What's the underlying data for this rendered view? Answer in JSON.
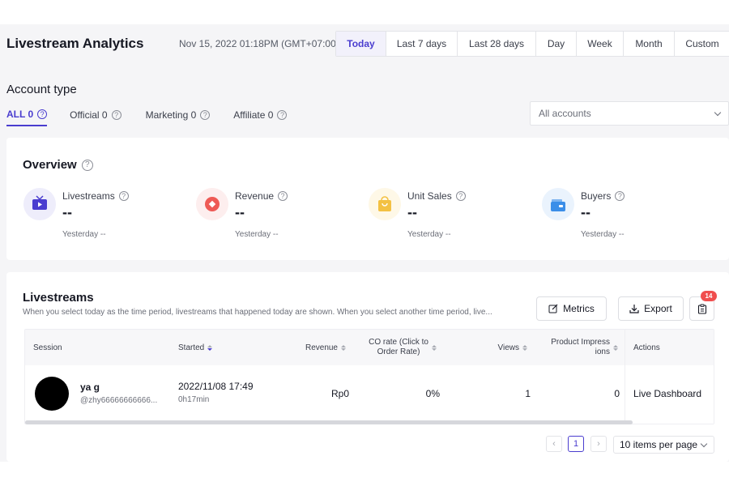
{
  "header": {
    "title": "Livestream Analytics",
    "datetime": "Nov 15, 2022 01:18PM (GMT+07:00)",
    "ranges": [
      "Today",
      "Last 7 days",
      "Last 28 days",
      "Day",
      "Week",
      "Month",
      "Custom"
    ],
    "active_range": "Today"
  },
  "account_type": {
    "title": "Account type",
    "tabs": [
      {
        "label": "ALL 0",
        "active": true
      },
      {
        "label": "Official 0",
        "active": false
      },
      {
        "label": "Marketing 0",
        "active": false
      },
      {
        "label": "Affiliate 0",
        "active": false
      }
    ],
    "select": {
      "value": "All accounts"
    }
  },
  "overview": {
    "title": "Overview",
    "metrics": [
      {
        "label": "Livestreams",
        "value": "--",
        "yesterday": "Yesterday --",
        "icon": "tv-icon",
        "color": "#4a3dcf",
        "bg": "#eeedfb"
      },
      {
        "label": "Revenue",
        "value": "--",
        "yesterday": "Yesterday --",
        "icon": "revenue-icon",
        "color": "#ee5a55",
        "bg": "#fdeeee"
      },
      {
        "label": "Unit Sales",
        "value": "--",
        "yesterday": "Yesterday --",
        "icon": "shopping-bag-icon",
        "color": "#f3c143",
        "bg": "#fef8e7"
      },
      {
        "label": "Buyers",
        "value": "--",
        "yesterday": "Yesterday --",
        "icon": "wallet-icon",
        "color": "#3b8ee8",
        "bg": "#eaf3fd"
      }
    ]
  },
  "livestreams": {
    "title": "Livestreams",
    "subtitle": "When you select today as the time period, livestreams that happened today are shown. When you select another time period, live...",
    "buttons": {
      "metrics": "Metrics",
      "export": "Export"
    },
    "badge_count": "14",
    "columns": {
      "session": "Session",
      "started": "Started",
      "revenue": "Revenue",
      "co_rate_1": "CO rate (Click to",
      "co_rate_2": "Order Rate)",
      "views": "Views",
      "impressions_1": "Product Impress",
      "impressions_2": "ions",
      "actions": "Actions"
    },
    "rows": [
      {
        "name": "ya g",
        "handle": "@zhy66666666666...",
        "started": "2022/11/08 17:49",
        "duration": "0h17min",
        "revenue": "Rp0",
        "co_rate": "0%",
        "views": "1",
        "impressions": "0",
        "action": "Live Dashboard"
      }
    ],
    "pagination": {
      "prev": "‹",
      "current": "1",
      "next": "›",
      "per_page": "10 items per page"
    }
  }
}
